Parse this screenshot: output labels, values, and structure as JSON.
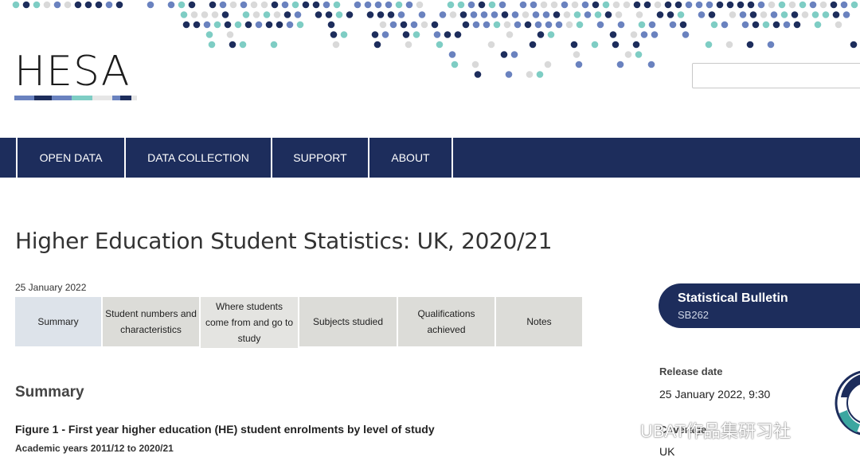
{
  "brand": {
    "logo_text": "HESA",
    "logo_colors": [
      "#6a82bf",
      "#1d2d5c",
      "#6a82bf",
      "#7ecdc4",
      "#e6e6e6",
      "#6a82bf",
      "#1d2d5c",
      "#e6e6e6"
    ],
    "dot_colors": [
      "#1d2d5c",
      "#6a82bf",
      "#7ecdc4",
      "#d9d9d9"
    ]
  },
  "search": {
    "placeholder": "",
    "icon": "search-box"
  },
  "nav": {
    "items": [
      {
        "label": "OPEN DATA"
      },
      {
        "label": "DATA COLLECTION"
      },
      {
        "label": "SUPPORT"
      },
      {
        "label": "ABOUT"
      }
    ]
  },
  "page": {
    "title": "Higher Education Student Statistics: UK, 2020/21",
    "pub_date": "25 January 2022"
  },
  "tabs": [
    {
      "label": "Summary"
    },
    {
      "label": "Student numbers and characteristics"
    },
    {
      "label": "Where students come from and go to study"
    },
    {
      "label": "Subjects studied"
    },
    {
      "label": "Qualifications achieved"
    },
    {
      "label": "Notes"
    }
  ],
  "content": {
    "section_heading": "Summary",
    "figure_title": "Figure 1 - First year higher education (HE) student enrolments by level of study",
    "figure_subtitle": "Academic years 2011/12 to 2020/21"
  },
  "sidebar": {
    "badge_title": "Statistical Bulletin",
    "badge_code": "SB262",
    "release_label": "Release date",
    "release_value": "25 January 2022, 9:30",
    "coverage_label": "Coverage",
    "coverage_value": "UK",
    "ns_badge_icon": "national-statistics-badge"
  },
  "watermark": {
    "text": "UBAT作品集研习社",
    "icon": "wechat-icon"
  },
  "colors": {
    "navy": "#1d2d5c",
    "tab_bg": "#dcdcd8",
    "tab_active": "#dde3ea"
  }
}
